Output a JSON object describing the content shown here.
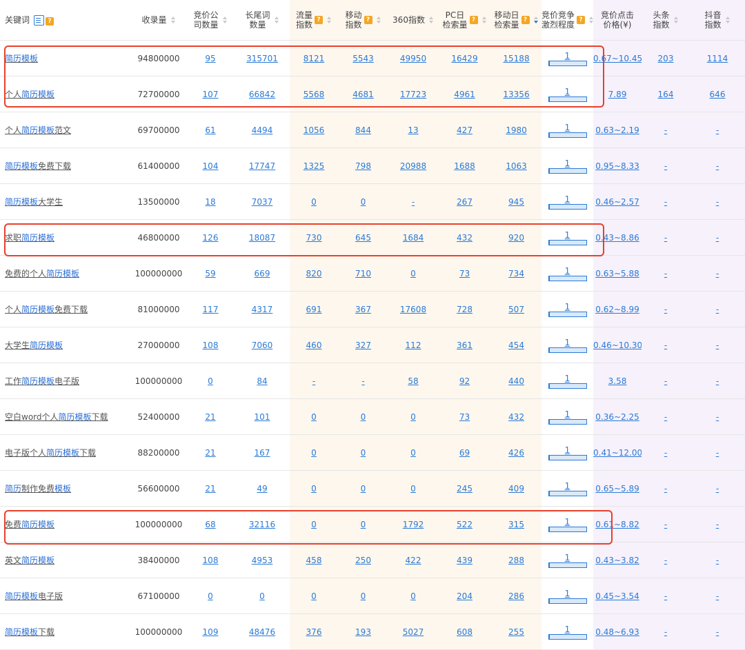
{
  "headers": {
    "keyword": "关键词",
    "index_count": "收录量",
    "bid_companies": [
      "竞价公",
      "司数量"
    ],
    "longtail": [
      "长尾词",
      "数量"
    ],
    "traffic": [
      "流量",
      "指数"
    ],
    "mobile": [
      "移动",
      "指数"
    ],
    "idx360": "360指数",
    "pc_daily": [
      "PC日",
      "检索量"
    ],
    "mobile_daily": [
      "移动日",
      "检索量"
    ],
    "competition": [
      "竞价竞争",
      "激烈程度"
    ],
    "click_price": [
      "竞价点击",
      "价格(¥)"
    ],
    "toutiao": [
      "头条",
      "指数"
    ],
    "douyin": [
      "抖音",
      "指数"
    ],
    "help_mark": "?"
  },
  "highlight_color": "#e8402a",
  "rows": [
    {
      "kw_pre": "",
      "kw_hl": "简历模板",
      "kw_post": "",
      "index": "94800000",
      "bid": "95",
      "longtail": "315701",
      "traffic": "8121",
      "mobile": "5543",
      "i360": "49950",
      "pc": "16429",
      "mob": "15188",
      "comp": "1",
      "price": "0.67~10.45",
      "toutiao": "203",
      "douyin": "1114"
    },
    {
      "kw_pre": "个人",
      "kw_hl": "简历模板",
      "kw_post": "",
      "index": "72700000",
      "bid": "107",
      "longtail": "66842",
      "traffic": "5568",
      "mobile": "4681",
      "i360": "17723",
      "pc": "4961",
      "mob": "13356",
      "comp": "1",
      "price": "7.89",
      "toutiao": "164",
      "douyin": "646"
    },
    {
      "kw_pre": "个人",
      "kw_hl": "简历模板",
      "kw_post": "范文",
      "index": "69700000",
      "bid": "61",
      "longtail": "4494",
      "traffic": "1056",
      "mobile": "844",
      "i360": "13",
      "pc": "427",
      "mob": "1980",
      "comp": "1",
      "price": "0.63~2.19",
      "toutiao": "-",
      "douyin": "-"
    },
    {
      "kw_pre": "",
      "kw_hl": "简历模板",
      "kw_post": "免费下载",
      "index": "61400000",
      "bid": "104",
      "longtail": "17747",
      "traffic": "1325",
      "mobile": "798",
      "i360": "20988",
      "pc": "1688",
      "mob": "1063",
      "comp": "1",
      "price": "0.95~8.33",
      "toutiao": "-",
      "douyin": "-"
    },
    {
      "kw_pre": "",
      "kw_hl": "简历模板",
      "kw_post": "大学生",
      "index": "13500000",
      "bid": "18",
      "longtail": "7037",
      "traffic": "0",
      "mobile": "0",
      "i360": "-",
      "pc": "267",
      "mob": "945",
      "comp": "1",
      "price": "0.46~2.57",
      "toutiao": "-",
      "douyin": "-"
    },
    {
      "kw_pre": "求职",
      "kw_hl": "简历模板",
      "kw_post": "",
      "index": "46800000",
      "bid": "126",
      "longtail": "18087",
      "traffic": "730",
      "mobile": "645",
      "i360": "1684",
      "pc": "432",
      "mob": "920",
      "comp": "1",
      "price": "0.43~8.86",
      "toutiao": "-",
      "douyin": "-"
    },
    {
      "kw_pre": "免费的个人",
      "kw_hl": "简历模板",
      "kw_post": "",
      "index": "100000000",
      "bid": "59",
      "longtail": "669",
      "traffic": "820",
      "mobile": "710",
      "i360": "0",
      "pc": "73",
      "mob": "734",
      "comp": "1",
      "price": "0.63~5.88",
      "toutiao": "-",
      "douyin": "-"
    },
    {
      "kw_pre": "个人",
      "kw_hl": "简历模板",
      "kw_post": "免费下载",
      "index": "81000000",
      "bid": "117",
      "longtail": "4317",
      "traffic": "691",
      "mobile": "367",
      "i360": "17608",
      "pc": "728",
      "mob": "507",
      "comp": "1",
      "price": "0.62~8.99",
      "toutiao": "-",
      "douyin": "-"
    },
    {
      "kw_pre": "大学生",
      "kw_hl": "简历模板",
      "kw_post": "",
      "index": "27000000",
      "bid": "108",
      "longtail": "7060",
      "traffic": "460",
      "mobile": "327",
      "i360": "112",
      "pc": "361",
      "mob": "454",
      "comp": "1",
      "price": "0.46~10.30",
      "toutiao": "-",
      "douyin": "-"
    },
    {
      "kw_pre": "工作",
      "kw_hl": "简历模板",
      "kw_post": "电子版",
      "index": "100000000",
      "bid": "0",
      "longtail": "84",
      "traffic": "-",
      "mobile": "-",
      "i360": "58",
      "pc": "92",
      "mob": "440",
      "comp": "1",
      "price": "3.58",
      "toutiao": "-",
      "douyin": "-"
    },
    {
      "kw_pre": "空白word个人",
      "kw_hl": "简历模板",
      "kw_post": "下载",
      "index": "52400000",
      "bid": "21",
      "longtail": "101",
      "traffic": "0",
      "mobile": "0",
      "i360": "0",
      "pc": "73",
      "mob": "432",
      "comp": "1",
      "price": "0.36~2.25",
      "toutiao": "-",
      "douyin": "-"
    },
    {
      "kw_pre": "电子版个人",
      "kw_hl": "简历模板",
      "kw_post": "下载",
      "index": "88200000",
      "bid": "21",
      "longtail": "167",
      "traffic": "0",
      "mobile": "0",
      "i360": "0",
      "pc": "69",
      "mob": "426",
      "comp": "1",
      "price": "0.41~12.00",
      "toutiao": "-",
      "douyin": "-"
    },
    {
      "kw_pre": "",
      "kw_hl": "简历",
      "kw_post": "制作免费",
      "kw_hl2": "模板",
      "index": "56600000",
      "bid": "21",
      "longtail": "49",
      "traffic": "0",
      "mobile": "0",
      "i360": "0",
      "pc": "245",
      "mob": "409",
      "comp": "1",
      "price": "0.65~5.89",
      "toutiao": "-",
      "douyin": "-"
    },
    {
      "kw_pre": "免费",
      "kw_hl": "简历模板",
      "kw_post": "",
      "index": "100000000",
      "bid": "68",
      "longtail": "32116",
      "traffic": "0",
      "mobile": "0",
      "i360": "1792",
      "pc": "522",
      "mob": "315",
      "comp": "1",
      "price": "0.61~8.82",
      "toutiao": "-",
      "douyin": "-"
    },
    {
      "kw_pre": "英文",
      "kw_hl": "简历模板",
      "kw_post": "",
      "index": "38400000",
      "bid": "108",
      "longtail": "4953",
      "traffic": "458",
      "mobile": "250",
      "i360": "422",
      "pc": "439",
      "mob": "288",
      "comp": "1",
      "price": "0.43~3.82",
      "toutiao": "-",
      "douyin": "-"
    },
    {
      "kw_pre": "",
      "kw_hl": "简历模板",
      "kw_post": "电子版",
      "index": "67100000",
      "bid": "0",
      "longtail": "0",
      "traffic": "0",
      "mobile": "0",
      "i360": "0",
      "pc": "204",
      "mob": "286",
      "comp": "1",
      "price": "0.45~3.54",
      "toutiao": "-",
      "douyin": "-"
    },
    {
      "kw_pre": "",
      "kw_hl": "简历模板",
      "kw_post": "下载",
      "index": "100000000",
      "bid": "109",
      "longtail": "48476",
      "traffic": "376",
      "mobile": "193",
      "i360": "5027",
      "pc": "608",
      "mob": "255",
      "comp": "1",
      "price": "0.48~6.93",
      "toutiao": "-",
      "douyin": "-"
    }
  ]
}
